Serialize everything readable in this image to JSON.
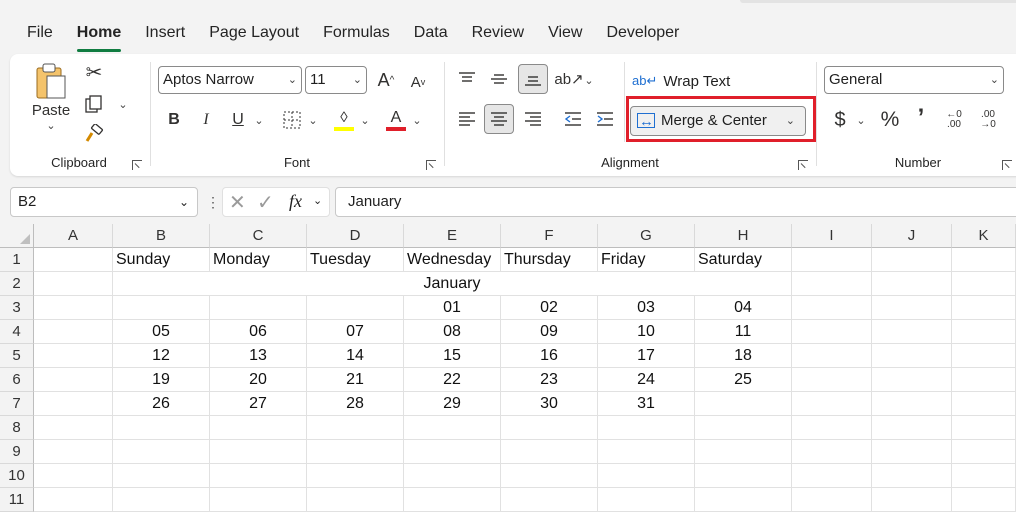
{
  "tabs": [
    "File",
    "Home",
    "Insert",
    "Page Layout",
    "Formulas",
    "Data",
    "Review",
    "View",
    "Developer"
  ],
  "ribbon": {
    "clipboard": {
      "paste_label": "Paste",
      "group_label": "Clipboard"
    },
    "font": {
      "name": "Aptos Narrow",
      "size": "11",
      "group_label": "Font"
    },
    "alignment": {
      "wrap_text": "Wrap Text",
      "merge_center": "Merge & Center",
      "group_label": "Alignment"
    },
    "number": {
      "format": "General",
      "group_label": "Number"
    }
  },
  "formula_bar": {
    "name_box": "B2",
    "formula": "January"
  },
  "columns": [
    "A",
    "B",
    "C",
    "D",
    "E",
    "F",
    "G",
    "H",
    "I",
    "J",
    "K"
  ],
  "rows": [
    "1",
    "2",
    "3",
    "4",
    "5",
    "6",
    "7",
    "8",
    "9",
    "10",
    "11"
  ],
  "sheet": {
    "day_headers": [
      "Sunday",
      "Monday",
      "Tuesday",
      "Wednesday",
      "Thursday",
      "Friday",
      "Saturday"
    ],
    "month": "January",
    "weeks": [
      [
        "",
        "",
        "",
        "01",
        "02",
        "03",
        "04"
      ],
      [
        "05",
        "06",
        "07",
        "08",
        "09",
        "10",
        "11"
      ],
      [
        "12",
        "13",
        "14",
        "15",
        "16",
        "17",
        "18"
      ],
      [
        "19",
        "20",
        "21",
        "22",
        "23",
        "24",
        "25"
      ],
      [
        "26",
        "27",
        "28",
        "29",
        "30",
        "31",
        ""
      ]
    ]
  },
  "colors": {
    "accent_green": "#107c41",
    "highlight_red": "#e01f2a"
  }
}
